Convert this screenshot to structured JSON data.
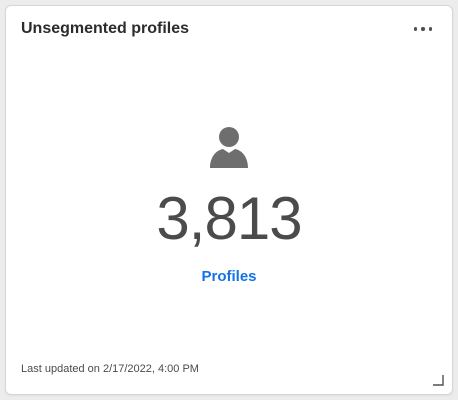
{
  "card": {
    "title": "Unsegmented profiles",
    "more_menu_icon": "ellipsis-icon",
    "profile_icon": "user-icon",
    "count": "3,813",
    "link_label": "Profiles",
    "last_updated": "Last updated on 2/17/2022, 4:00 PM",
    "resize_icon": "resize-handle-icon"
  },
  "colors": {
    "link": "#1473e6",
    "icon": "#6e6e6e",
    "count_text": "#4b4b4b"
  }
}
